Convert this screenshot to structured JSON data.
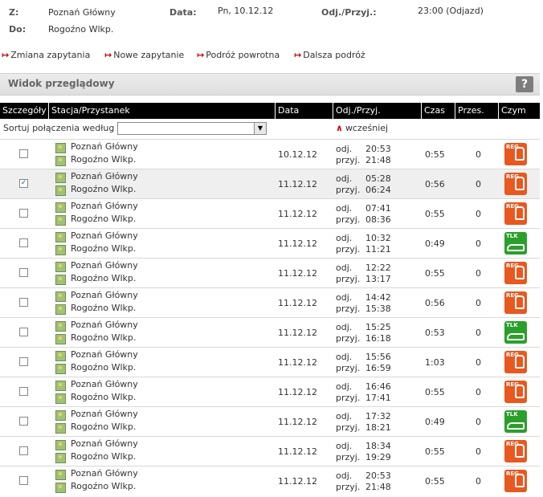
{
  "header": {
    "from_label": "Z:",
    "from_value": "Poznań Główny",
    "to_label": "Do:",
    "to_value": "Rogoźno Wlkp.",
    "date_label": "Data:",
    "date_value": "Pn, 10.12.12",
    "time_label": "Odj./Przyj.:",
    "time_value": "23:00 (Odjazd)"
  },
  "links": [
    "Zmiana zapytania",
    "Nowe zapytanie",
    "Podróż powrotna",
    "Dalsza podróż"
  ],
  "section": {
    "title": "Widok przeglądowy",
    "help": "?"
  },
  "columns": [
    "Szczegóły",
    "Stacja/Przystanek",
    "Data",
    "Odj./Przyj.",
    "Czas",
    "Przes.",
    "Czym"
  ],
  "sort": {
    "label": "Sortuj połączenia według",
    "selected": "",
    "earlier": "wcześniej"
  },
  "labels": {
    "dep": "odj.",
    "arr": "przyj."
  },
  "rows": [
    {
      "from": "Poznań Główny",
      "to": "Rogoźno Wlkp.",
      "date": "10.12.12",
      "dep": "20:53",
      "arr": "21:48",
      "duration": "0:55",
      "changes": "0",
      "product": "REG",
      "checked": false
    },
    {
      "from": "Poznań Główny",
      "to": "Rogoźno Wlkp.",
      "date": "11.12.12",
      "dep": "05:28",
      "arr": "06:24",
      "duration": "0:56",
      "changes": "0",
      "product": "REG",
      "checked": true
    },
    {
      "from": "Poznań Główny",
      "to": "Rogoźno Wlkp.",
      "date": "11.12.12",
      "dep": "07:41",
      "arr": "08:36",
      "duration": "0:55",
      "changes": "0",
      "product": "REG",
      "checked": false
    },
    {
      "from": "Poznań Główny",
      "to": "Rogoźno Wlkp.",
      "date": "11.12.12",
      "dep": "10:32",
      "arr": "11:21",
      "duration": "0:49",
      "changes": "0",
      "product": "TLK",
      "checked": false
    },
    {
      "from": "Poznań Główny",
      "to": "Rogoźno Wlkp.",
      "date": "11.12.12",
      "dep": "12:22",
      "arr": "13:17",
      "duration": "0:55",
      "changes": "0",
      "product": "REG",
      "checked": false
    },
    {
      "from": "Poznań Główny",
      "to": "Rogoźno Wlkp.",
      "date": "11.12.12",
      "dep": "14:42",
      "arr": "15:38",
      "duration": "0:56",
      "changes": "0",
      "product": "REG",
      "checked": false
    },
    {
      "from": "Poznań Główny",
      "to": "Rogoźno Wlkp.",
      "date": "11.12.12",
      "dep": "15:25",
      "arr": "16:18",
      "duration": "0:53",
      "changes": "0",
      "product": "TLK",
      "checked": false
    },
    {
      "from": "Poznań Główny",
      "to": "Rogoźno Wlkp.",
      "date": "11.12.12",
      "dep": "15:56",
      "arr": "16:59",
      "duration": "1:03",
      "changes": "0",
      "product": "REG",
      "checked": false
    },
    {
      "from": "Poznań Główny",
      "to": "Rogoźno Wlkp.",
      "date": "11.12.12",
      "dep": "16:46",
      "arr": "17:41",
      "duration": "0:55",
      "changes": "0",
      "product": "REG",
      "checked": false
    },
    {
      "from": "Poznań Główny",
      "to": "Rogoźno Wlkp.",
      "date": "11.12.12",
      "dep": "17:32",
      "arr": "18:21",
      "duration": "0:49",
      "changes": "0",
      "product": "TLK",
      "checked": false
    },
    {
      "from": "Poznań Główny",
      "to": "Rogoźno Wlkp.",
      "date": "11.12.12",
      "dep": "18:34",
      "arr": "19:29",
      "duration": "0:55",
      "changes": "0",
      "product": "REG",
      "checked": false
    },
    {
      "from": "Poznań Główny",
      "to": "Rogoźno Wlkp.",
      "date": "11.12.12",
      "dep": "20:53",
      "arr": "21:48",
      "duration": "0:55",
      "changes": "0",
      "product": "REG",
      "checked": false
    }
  ],
  "colors": {
    "reg": "#e8581f",
    "tlk": "#2aa02a",
    "arrow": "#cc0000",
    "header_bg": "#000000"
  },
  "icons": {
    "map": "map-icon",
    "link_arrow": "arrow-right-icon",
    "earlier": "caret-up-icon",
    "reg": "regional-train-icon",
    "tlk": "tlk-train-icon"
  }
}
